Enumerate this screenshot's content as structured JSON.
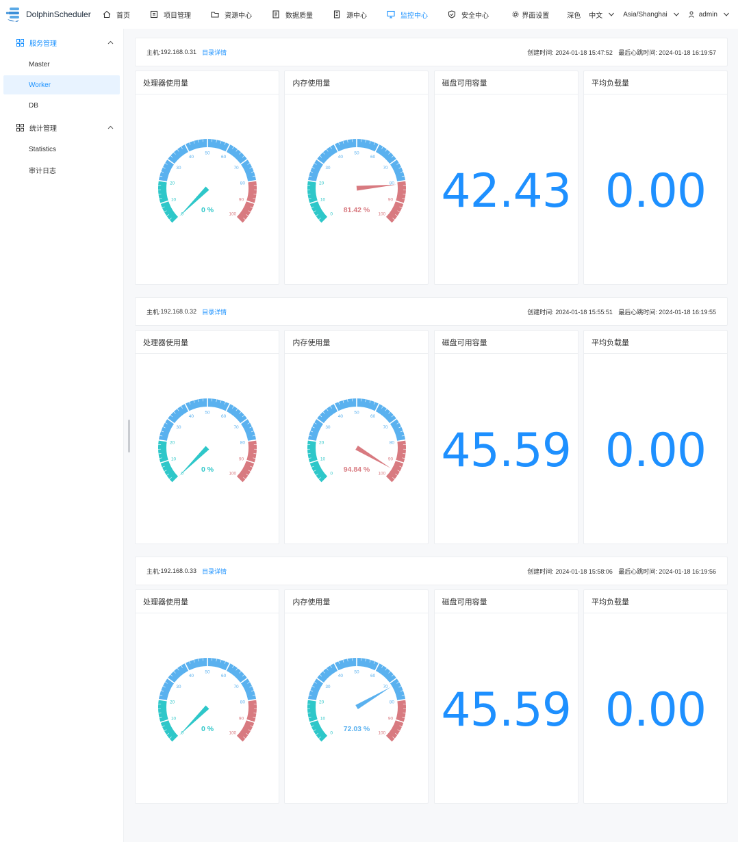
{
  "app": {
    "name": "DolphinScheduler"
  },
  "nav": {
    "items": [
      {
        "label": "首页",
        "icon": "home-icon"
      },
      {
        "label": "项目管理",
        "icon": "project-icon"
      },
      {
        "label": "资源中心",
        "icon": "folder-icon"
      },
      {
        "label": "数据质量",
        "icon": "document-icon"
      },
      {
        "label": "源中心",
        "icon": "datasource-icon"
      },
      {
        "label": "监控中心",
        "icon": "monitor-icon",
        "active": true
      },
      {
        "label": "安全中心",
        "icon": "shield-icon"
      }
    ],
    "settings": "界面设置",
    "theme": "深色",
    "language": "中文",
    "timezone": "Asia/Shanghai",
    "user": "admin"
  },
  "sidebar": {
    "groups": [
      {
        "label": "服务管理",
        "active": true,
        "items": [
          "Master",
          "Worker",
          "DB"
        ]
      },
      {
        "label": "统计管理",
        "active": false,
        "items": [
          "Statistics",
          "审计日志"
        ]
      }
    ],
    "active_item": "Worker"
  },
  "labels": {
    "host_prefix": "主机: ",
    "dir_detail": "目录详情",
    "created_prefix": "创建时间: ",
    "heartbeat_prefix": "最后心跳时间: ",
    "cpu": "处理器使用量",
    "memory": "内存使用量",
    "disk": "磁盘可用容量",
    "load": "平均负载量"
  },
  "colors": {
    "accent": "#1890ff",
    "gauge_low": "#2ec7c9",
    "gauge_mid": "#5ab1ef",
    "gauge_high": "#d87a80"
  },
  "workers": [
    {
      "host": "192.168.0.31",
      "created": "2024-01-18 15:47:52",
      "heartbeat": "2024-01-18 16:19:57",
      "cpu": 0,
      "memory": 81.42,
      "disk": "42.43",
      "load": "0.00"
    },
    {
      "host": "192.168.0.32",
      "created": "2024-01-18 15:55:51",
      "heartbeat": "2024-01-18 16:19:55",
      "cpu": 0,
      "memory": 94.84,
      "disk": "45.59",
      "load": "0.00"
    },
    {
      "host": "192.168.0.33",
      "created": "2024-01-18 15:58:06",
      "heartbeat": "2024-01-18 16:19:56",
      "cpu": 0,
      "memory": 72.03,
      "disk": "45.59",
      "load": "0.00"
    }
  ]
}
